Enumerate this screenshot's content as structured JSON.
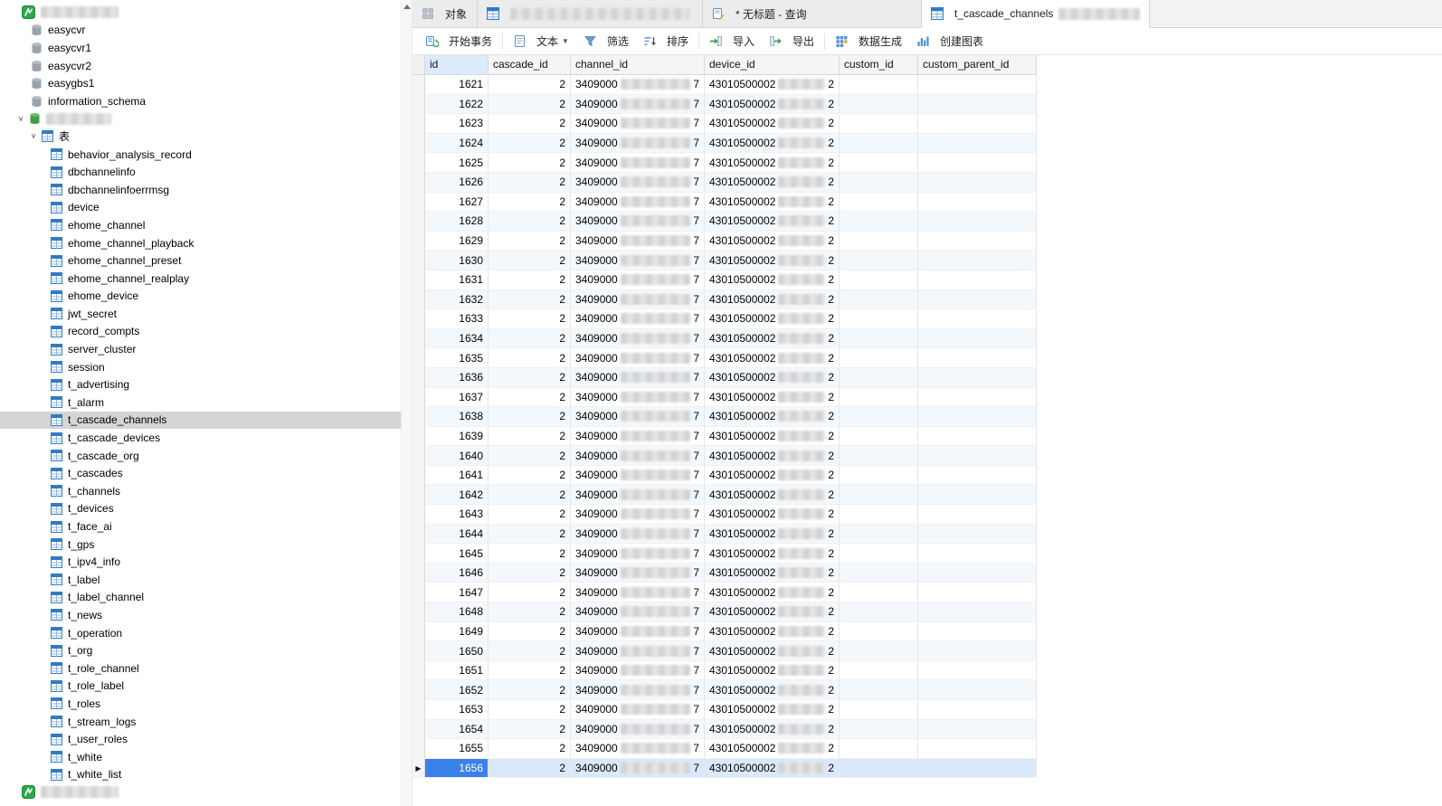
{
  "sidebar": {
    "connection": {
      "name_redacted": true
    },
    "databases": [
      "easycvr",
      "easycvr1",
      "easycvr2",
      "easygbs1",
      "information_schema"
    ],
    "open_database": {
      "name_redacted": true
    },
    "tables_folder_label": "表",
    "selected_table": "t_cascade_channels",
    "tables": [
      "behavior_analysis_record",
      "dbchannelinfo",
      "dbchannelinfoerrmsg",
      "device",
      "ehome_channel",
      "ehome_channel_playback",
      "ehome_channel_preset",
      "ehome_channel_realplay",
      "ehome_device",
      "jwt_secret",
      "record_compts",
      "server_cluster",
      "session",
      "t_advertising",
      "t_alarm",
      "t_cascade_channels",
      "t_cascade_devices",
      "t_cascade_org",
      "t_cascades",
      "t_channels",
      "t_devices",
      "t_face_ai",
      "t_gps",
      "t_ipv4_info",
      "t_label",
      "t_label_channel",
      "t_news",
      "t_operation",
      "t_org",
      "t_role_channel",
      "t_role_label",
      "t_roles",
      "t_stream_logs",
      "t_user_roles",
      "t_white",
      "t_white_list"
    ]
  },
  "tabs": {
    "objects": {
      "label": "对象"
    },
    "connection_tab": {
      "label_redacted": true
    },
    "query": {
      "label": "* 无标题 - 查询"
    },
    "table_data": {
      "label": "t_cascade_channels",
      "suffix_redacted": true
    }
  },
  "toolbar": {
    "begin_transaction": "开始事务",
    "text": "文本",
    "filter": "筛选",
    "sort": "排序",
    "import": "导入",
    "export": "导出",
    "data_generation": "数据生成",
    "create_chart": "创建图表"
  },
  "grid": {
    "columns": [
      "id",
      "cascade_id",
      "channel_id",
      "device_id",
      "custom_id",
      "custom_parent_id"
    ],
    "cell_values": {
      "cascade_id": "2",
      "channel_id_visible_prefix": "3409000",
      "channel_id_visible_suffix": "7",
      "device_id_visible_prefix": "43010500002",
      "device_id_visible_suffix": "2",
      "custom_id": "",
      "custom_parent_id": ""
    },
    "row_ids": [
      1621,
      1622,
      1623,
      1624,
      1625,
      1626,
      1627,
      1628,
      1629,
      1630,
      1631,
      1632,
      1633,
      1634,
      1635,
      1636,
      1637,
      1638,
      1639,
      1640,
      1641,
      1642,
      1643,
      1644,
      1645,
      1646,
      1647,
      1648,
      1649,
      1650,
      1651,
      1652,
      1653,
      1654,
      1655,
      1656
    ],
    "selected_row_id": 1656
  },
  "colors": {
    "selected_cell_blue": "#3b82e8",
    "selected_row_tint": "#d9e9fb",
    "tree_selected_gray": "#d5d5d5",
    "stripe_blue": "#f3f8fd",
    "redaction_gray": "#d9d9d9",
    "table_icon_blue": "#2f7cc4",
    "db_icon_gray": "#9aa2ab",
    "db_icon_green": "#43a047",
    "connection_icon_green": "#2ba84a"
  }
}
